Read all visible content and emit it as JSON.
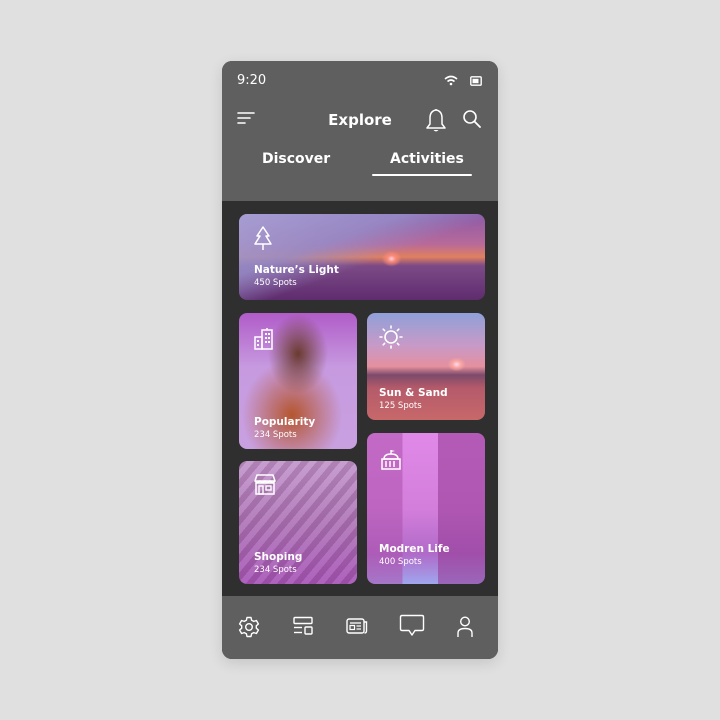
{
  "status_bar": {
    "time": "9:20",
    "wifi_icon": "wifi-icon",
    "battery_icon": "battery-icon"
  },
  "header": {
    "title": "Explore",
    "menu_icon": "menu-icon",
    "notification_icon": "bell-icon",
    "search_icon": "search-icon"
  },
  "tabs": [
    {
      "label": "Discover",
      "active": false
    },
    {
      "label": "Activities",
      "active": true
    }
  ],
  "cards": [
    {
      "title": "Nature’s Light",
      "subtitle": "450 Spots",
      "icon": "tree-icon"
    },
    {
      "title": "Popularity",
      "subtitle": "234 Spots",
      "icon": "buildings-icon"
    },
    {
      "title": "Sun & Sand",
      "subtitle": "125 Spots",
      "icon": "sun-icon"
    },
    {
      "title": "Modren Life",
      "subtitle": "400 Spots",
      "icon": "government-building-icon"
    },
    {
      "title": "Shoping",
      "subtitle": "234 Spots",
      "icon": "store-icon"
    }
  ],
  "bottom_nav": [
    {
      "icon": "gear-icon"
    },
    {
      "icon": "layout-icon"
    },
    {
      "icon": "news-icon"
    },
    {
      "icon": "chat-icon"
    },
    {
      "icon": "user-icon"
    }
  ],
  "colors": {
    "header_bg": "#5f5f5f",
    "content_bg": "#2f2f2f",
    "page_bg": "#e0e0e0",
    "text": "#ffffff"
  }
}
